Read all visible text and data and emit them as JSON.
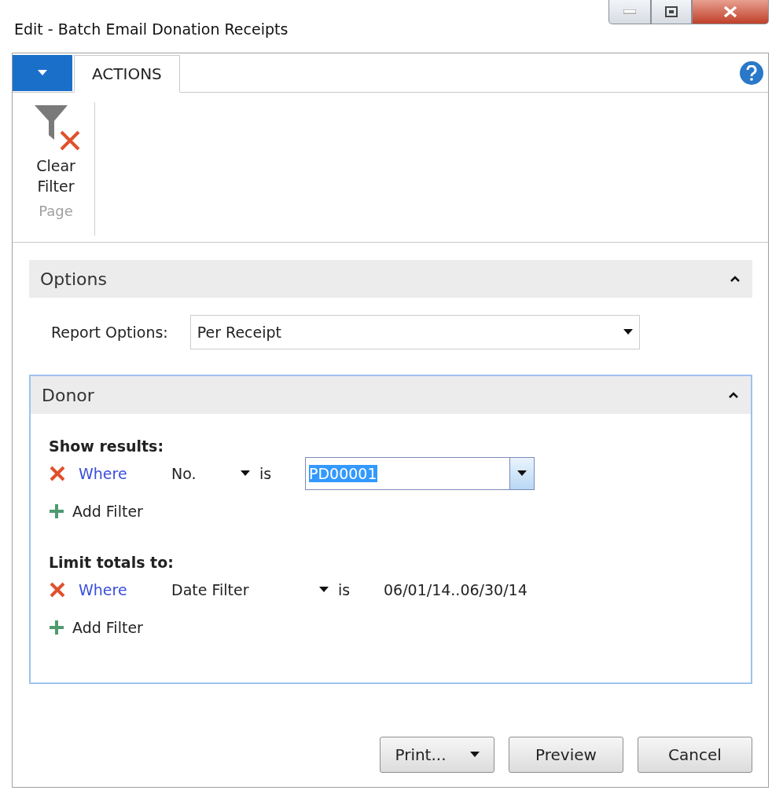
{
  "window": {
    "title": "Edit - Batch Email Donation Receipts"
  },
  "ribbon": {
    "tabs": [
      {
        "label": "ACTIONS",
        "selected": true
      }
    ],
    "actions": [
      {
        "label": "Clear Filter"
      }
    ],
    "group": "Page"
  },
  "options": {
    "title": "Options",
    "expanded": true,
    "fields": [
      {
        "label": "Report Options:",
        "value": "Per Receipt"
      }
    ]
  },
  "donor": {
    "title": "Donor",
    "expanded": true,
    "groups": [
      {
        "heading": "Show results:",
        "filters": [
          {
            "where": "Where",
            "field": "No.",
            "operator": "is",
            "kind": "input",
            "value": "PD00001"
          }
        ],
        "add": "Add Filter"
      },
      {
        "heading": "Limit totals to:",
        "filters": [
          {
            "where": "Where",
            "field": "Date Filter",
            "operator": "is",
            "kind": "text",
            "value": "06/01/14..06/30/14"
          }
        ],
        "add": "Add Filter"
      }
    ]
  },
  "buttons": [
    {
      "label": "Print...",
      "kind": "split"
    },
    {
      "label": "Preview",
      "kind": "plain"
    },
    {
      "label": "Cancel",
      "kind": "plain"
    }
  ]
}
